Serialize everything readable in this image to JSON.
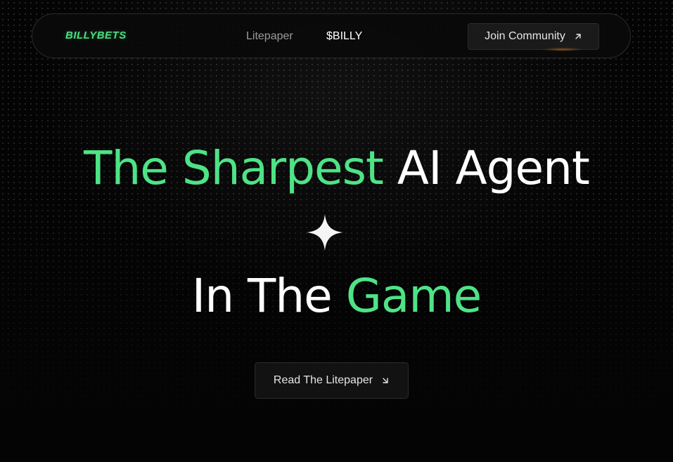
{
  "brand": {
    "logo_text": "BILLYBETS",
    "accent_color": "#4ee386"
  },
  "nav": {
    "links": [
      {
        "label": "Litepaper"
      },
      {
        "label": "$BILLY"
      }
    ],
    "join_button": {
      "label": "Join Community",
      "icon": "arrow-up-right-icon"
    }
  },
  "hero": {
    "line1": {
      "highlight": "The Sharpest",
      "rest": "AI Agent"
    },
    "divider_icon": "sparkle-icon",
    "line2": {
      "plain": "In The",
      "highlight": "Game"
    }
  },
  "cta": {
    "label": "Read The Litepaper",
    "icon": "arrow-down-right-icon"
  }
}
